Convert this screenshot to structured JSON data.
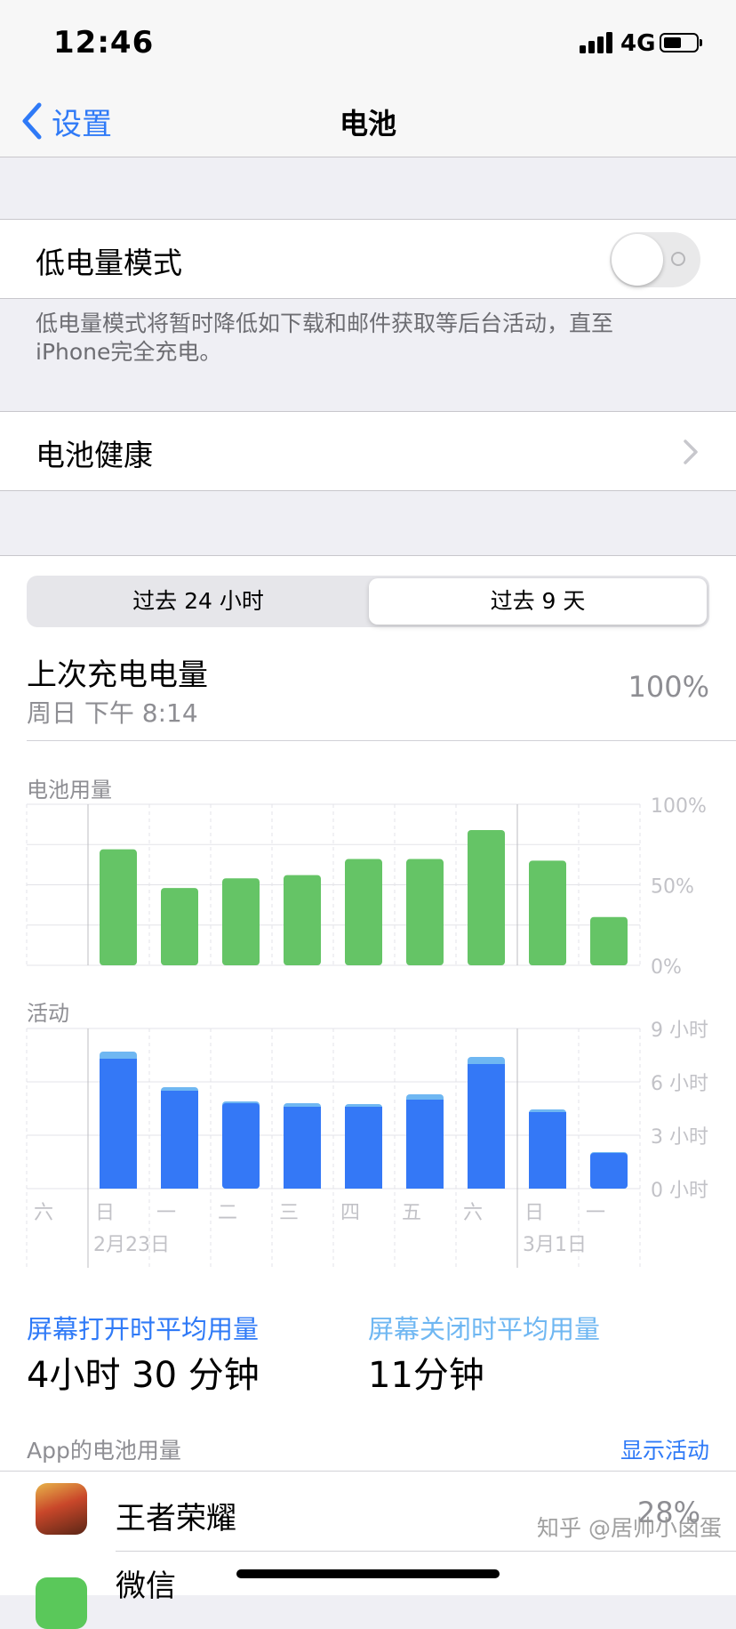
{
  "status_bar": {
    "time": "12:46",
    "network": "4G",
    "battery_level": 0.55
  },
  "nav": {
    "back_label": "设置",
    "title": "电池"
  },
  "low_power": {
    "label": "低电量模式",
    "enabled": false,
    "note": "低电量模式将暂时降低如下载和邮件获取等后台活动，直至iPhone完全充电。"
  },
  "battery_health": {
    "label": "电池健康"
  },
  "segmented": {
    "options": [
      "过去 24 小时",
      "过去 9 天"
    ],
    "selected": 1
  },
  "last_charge": {
    "title": "上次充电电量",
    "time": "周日 下午 8:14",
    "value": "100%"
  },
  "chart_data": [
    {
      "type": "bar",
      "title": "电池用量",
      "categories": [
        "日",
        "一",
        "二",
        "三",
        "四",
        "五",
        "六",
        "日",
        "一"
      ],
      "values": [
        72,
        48,
        54,
        56,
        66,
        66,
        84,
        65,
        30
      ],
      "ylim": [
        0,
        100
      ],
      "y_tick_labels": [
        "100%",
        "50%",
        "0%"
      ],
      "color": "#65c466"
    },
    {
      "type": "bar",
      "title": "活动",
      "categories": [
        "六",
        "日",
        "一",
        "二",
        "三",
        "四",
        "五",
        "六",
        "日",
        "一"
      ],
      "series": [
        {
          "name": "屏幕打开",
          "values": [
            0,
            7.3,
            5.5,
            4.8,
            4.6,
            4.6,
            5.0,
            7.0,
            4.3,
            2.0
          ],
          "color": "#3478f6"
        },
        {
          "name": "屏幕关闭",
          "values": [
            0,
            0.4,
            0.2,
            0.1,
            0.2,
            0.15,
            0.3,
            0.4,
            0.15,
            0.05
          ],
          "color": "#6fb7f2"
        }
      ],
      "ylim": [
        0,
        9
      ],
      "y_tick_labels": [
        "9 小时",
        "6 小时",
        "3 小时",
        "0 小时"
      ],
      "date_labels": [
        "2月23日",
        "3月1日"
      ]
    }
  ],
  "averages": {
    "screen_on_label": "屏幕打开时平均用量",
    "screen_on_value": "4小时 30 分钟",
    "screen_off_label": "屏幕关闭时平均用量",
    "screen_off_value": "11分钟"
  },
  "apps": {
    "header": "App的电池用量",
    "toggle_label": "显示活动",
    "items": [
      {
        "name": "王者荣耀",
        "percent": "28%"
      },
      {
        "name": "微信",
        "percent": ""
      }
    ]
  },
  "watermark": "知乎 @居帅小卤蛋"
}
